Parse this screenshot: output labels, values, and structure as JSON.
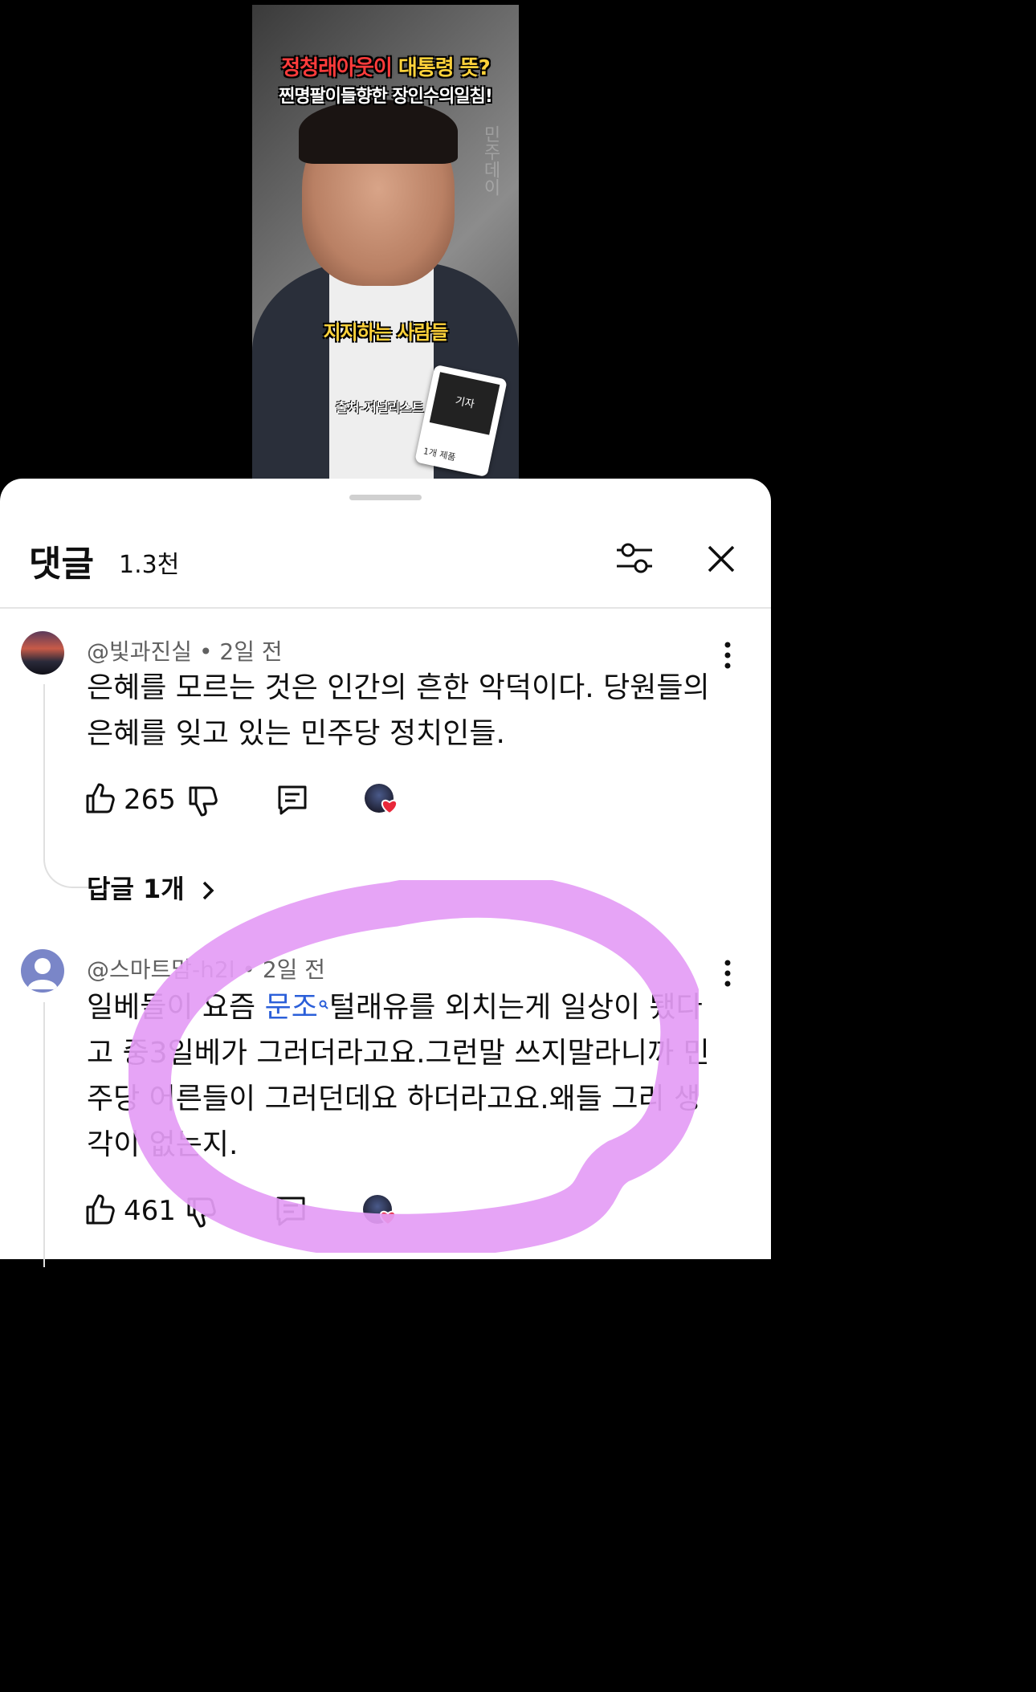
{
  "video": {
    "title_red": "정청래아웃이",
    "title_yellow": "대통령 뜻?",
    "subtitle": "찐명팔이들향한 장인수의일침!",
    "caption": "지지하는 사람들",
    "source": "출처-저널리스트",
    "watermark": "민주데이",
    "product_book": "기자",
    "product_count": "1개 제품"
  },
  "comments_header": {
    "title": "댓글",
    "count": "1.3천",
    "filter_icon": "sliders-icon",
    "close_icon": "close-icon"
  },
  "comments": [
    {
      "author": "@빛과진실",
      "time": "2일 전",
      "text": "은혜를 모르는 것은 인간의 흔한 악덕이다. 당원들의 은혜를 잊고 있는 민주당 정치인들.",
      "likes": "265",
      "replies_label": "답글 1개"
    },
    {
      "author": "@스마트맘-h2l",
      "time": "2일 전",
      "text_pre": "일베들이 요즘 ",
      "text_link": "문조",
      "text_post": "털래유를 외치는게 일상이 됐다고 중3일베가 그러더라고요.그런말 쓰지말라니까 민주당 어른들이 그러던데요 하더라고요.왜들 그리 생각이 없는지.",
      "likes": "461"
    }
  ],
  "colors": {
    "highlight": "#e49cf5",
    "heart": "#e8283a",
    "link": "#2b5fd9"
  }
}
